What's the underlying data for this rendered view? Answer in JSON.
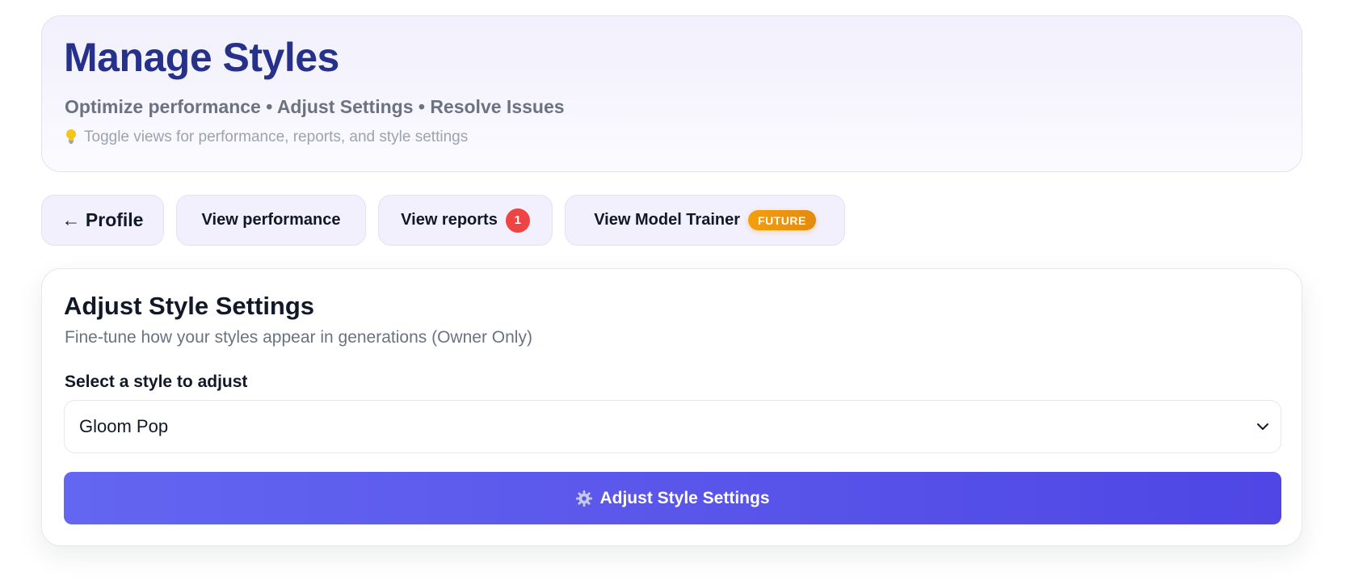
{
  "header": {
    "title": "Manage Styles",
    "subtitle": "Optimize performance • Adjust Settings • Resolve Issues",
    "hint": "Toggle views for performance, reports, and style settings",
    "hint_icon": "lightbulb-icon"
  },
  "nav": {
    "profile_label": "← Profile",
    "performance_label": "View performance",
    "reports_label": "View reports",
    "reports_count": "1",
    "trainer_label": "View Model Trainer",
    "trainer_badge": "FUTURE"
  },
  "settings": {
    "title": "Adjust Style Settings",
    "description": "Fine-tune how your styles appear in generations (Owner Only)",
    "select_label": "Select a style to adjust",
    "selected_style": "Gloom Pop",
    "submit_label": "Adjust Style Settings",
    "submit_icon": "gear-icon"
  },
  "colors": {
    "title": "#25318a",
    "accent": "#4f46e5",
    "badge_red": "#ef4444",
    "badge_orange": "#f59e0b"
  }
}
